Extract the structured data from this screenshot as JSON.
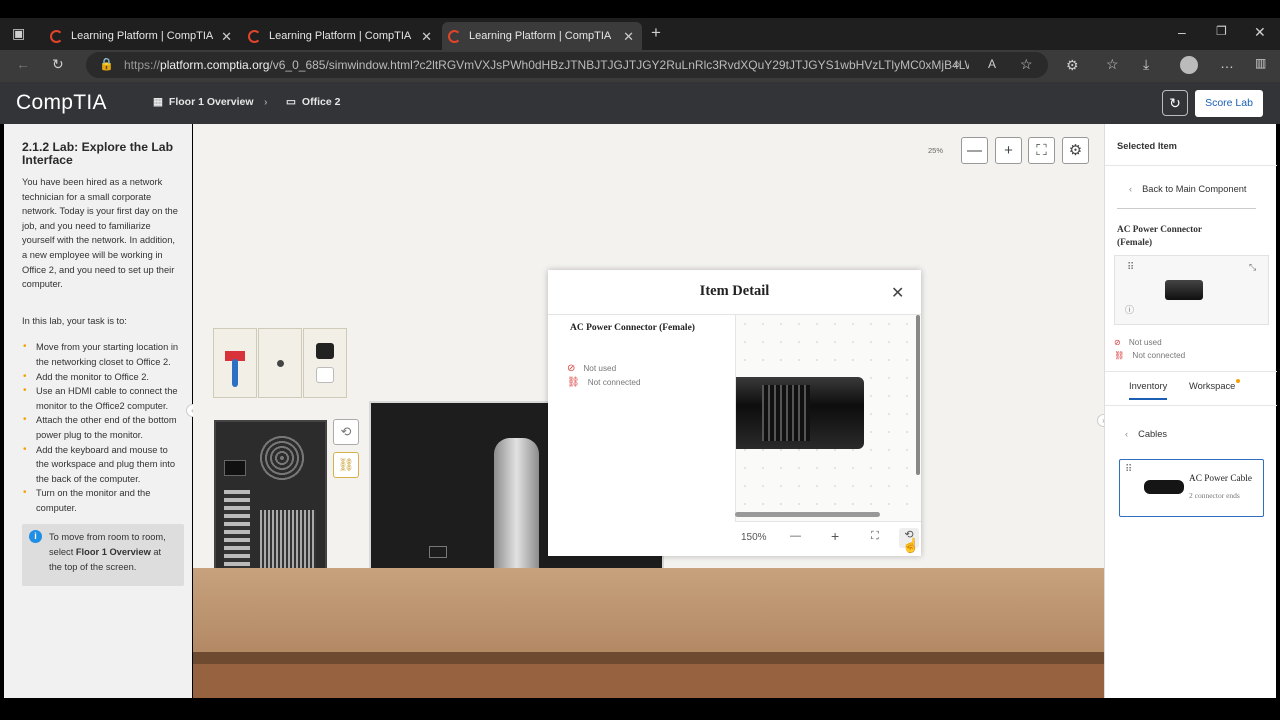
{
  "browser": {
    "tabs": [
      {
        "title": "Learning Platform | CompTIA"
      },
      {
        "title": "Learning Platform | CompTIA"
      },
      {
        "title": "Learning Platform | CompTIA"
      }
    ],
    "url_prefix": "https://",
    "url_domain": "platform.comptia.org",
    "url_rest": "/v6_0_685/simwindow.html?c2ltRGVmVXJsPWh0dHBzJTNBJTJGJTJGY2RuLnRlc3RvdXQuY29tJTJGYS1wbHVzLTlyMC0xMjB4LWVuL..."
  },
  "app": {
    "logo": "CompTIA",
    "breadcrumb": [
      "Floor 1 Overview",
      "Office 2"
    ],
    "score_label": "Score Lab"
  },
  "instructions": {
    "title": "2.1.2 Lab: Explore the Lab Interface",
    "intro": "You have been hired as a network technician for a small corporate network. Today is your first day on the job, and you need to familiarize yourself with the network. In addition, a new employee will be working in Office 2, and you need to set up their computer.",
    "task_lead": "In this lab, your task is to:",
    "tasks": [
      "Move from your starting location in the networking closet to Office 2.",
      "Add the monitor to Office 2.",
      "Use an HDMI cable to connect the monitor to the Office2 computer.",
      "Attach the other end of the bottom power plug to the monitor.",
      "Add the keyboard and mouse to the workspace and plug them into the back of the computer.",
      "Turn on the monitor and the computer."
    ],
    "tip_prefix": "To move from room to room, select ",
    "tip_bold": "Floor 1 Overview",
    "tip_suffix": " at the top of the screen."
  },
  "workspace": {
    "zoom": "25%"
  },
  "item_detail": {
    "title": "Item Detail",
    "name": "AC Power Connector (Female)",
    "status_used": "Not used",
    "status_connected": "Not connected",
    "zoom": "150%"
  },
  "selected_item": {
    "header": "Selected Item",
    "back_label": "Back to Main Component",
    "name": "AC Power Connector (Female)",
    "status_used": "Not used",
    "status_connected": "Not connected",
    "tabs": [
      "Inventory",
      "Workspace"
    ],
    "category": "Cables",
    "cable_name": "AC Power Cable",
    "cable_detail": "2 connector ends"
  },
  "colors": {
    "accent_blue": "#1a5fb4",
    "comptia_red": "#e0452b",
    "task_bullet": "#f2a400",
    "status_red": "#d93b3b"
  }
}
